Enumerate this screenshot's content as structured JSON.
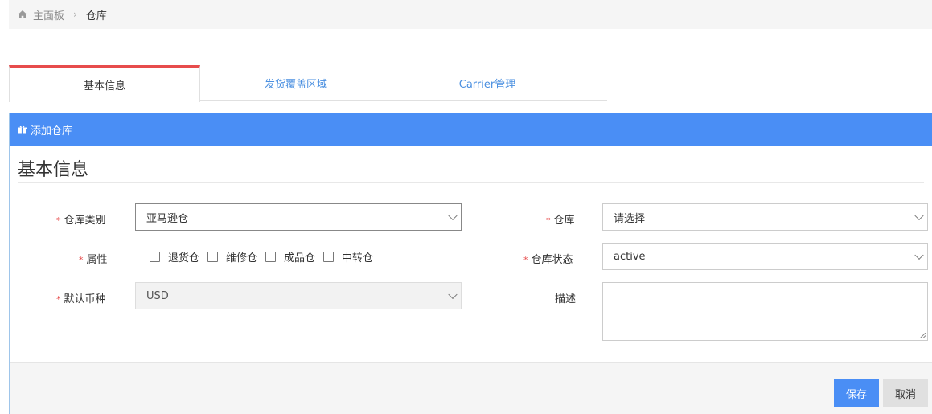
{
  "breadcrumb": {
    "home_icon": "home-icon",
    "home_label": "主面板",
    "separator": "›",
    "current": "仓库"
  },
  "tabs": [
    {
      "label": "基本信息",
      "active": true
    },
    {
      "label": "发货覆盖区域",
      "active": false
    },
    {
      "label": "Carrier管理",
      "active": false
    }
  ],
  "panel": {
    "header_icon": "gift-icon",
    "header_title": "添加仓库",
    "section_title": "基本信息"
  },
  "form": {
    "required_mark": "*",
    "warehouse_type": {
      "label": "仓库类别",
      "value": "亚马逊仓"
    },
    "attributes": {
      "label": "属性",
      "options": [
        "退货仓",
        "维修仓",
        "成品仓",
        "中转仓"
      ]
    },
    "currency": {
      "label": "默认币种",
      "value": "USD"
    },
    "warehouse": {
      "label": "仓库",
      "value": "请选择"
    },
    "status": {
      "label": "仓库状态",
      "value": "active"
    },
    "description": {
      "label": "描述",
      "value": ""
    }
  },
  "buttons": {
    "save": "保存",
    "cancel": "取消"
  },
  "colors": {
    "primary": "#4a8ef5",
    "tab_active_border": "#e74c4c",
    "required": "#e74c4c"
  }
}
